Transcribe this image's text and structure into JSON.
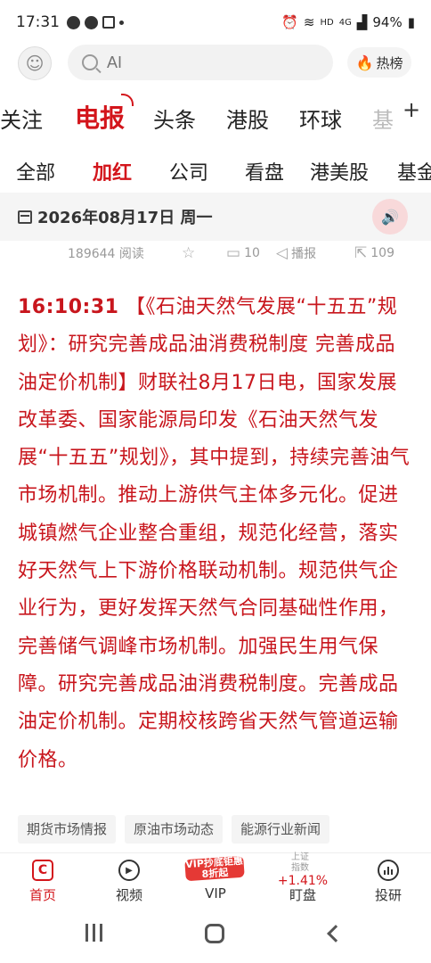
{
  "status_bar": {
    "time": "17:31",
    "battery": "94%",
    "network": "HD",
    "signal": "4G"
  },
  "header": {
    "search_placeholder": "AI",
    "hot_label": "热榜"
  },
  "channels": [
    "关注",
    "电报",
    "头条",
    "港股",
    "环球",
    "基"
  ],
  "active_channel": "电报",
  "subtabs": [
    "全部",
    "加红",
    "公司",
    "看盘",
    "港美股",
    "基金"
  ],
  "active_subtab": "加红",
  "date_bar": {
    "date": "2026年08月17日 周一"
  },
  "meta": {
    "views": "189644 阅读",
    "comments": "10",
    "broadcast_label": "播报",
    "shares": "109"
  },
  "article": {
    "time": "16:10:31",
    "text": "【《石油天然气发展“十五五”规划》：研究完善成品油消费税制度 完善成品油定价机制】财联社8月17日电，国家发展改革委、国家能源局印发《石油天然气发展“十五五”规划》，其中提到，持续完善油气市场机制。推动上游供气主体多元化。促进城镇燃气企业整合重组，规范化经营，落实好天然气上下游价格联动机制。规范供气企业行为，更好发挥天然气合同基础性作用，完善储气调峰市场机制。加强民生用气保障。研究完善成品油消费税制度。完善成品油定价机制。定期校核跨省天然气管道运输价格。"
  },
  "tags": [
    "期货市场情报",
    "原油市场动态",
    "能源行业新闻"
  ],
  "bottom_nav": {
    "home": "首页",
    "video": "视频",
    "vip": "VIP",
    "vip_badge": "VIP抄底钜惠8折起",
    "market": "盯盘",
    "market_index_label": "上证指数",
    "market_index_change": "+1.41%",
    "research": "投研"
  },
  "colors": {
    "accent": "#d3151b",
    "article_text": "#c8161d"
  }
}
